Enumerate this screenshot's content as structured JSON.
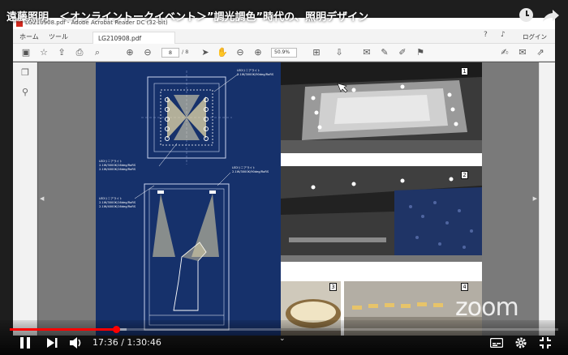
{
  "video": {
    "title": "遠藤照明　＜オンライントークイベント＞”調光調色”時代の、照明デザイン",
    "elapsed": "17:36",
    "separator": " / ",
    "duration": "1:30:46",
    "progress": 0.194,
    "buffered": 0.213
  },
  "acrobat": {
    "window_title": "LG210908.pdf - Adobe Acrobat Reader DC (32-bit)",
    "menu": {
      "home": "ホーム",
      "tools": "ツール",
      "doc_tab": "LG210908.pdf"
    },
    "login": "ログイン",
    "current_page": "8",
    "total_pages": "/ 8",
    "zoom": "50.9%"
  },
  "blueprint": {
    "label_a_1": "LEDリニアライト",
    "label_a_2": "2.1W/3000K/90deg/RaRS",
    "label_b_1": "LEDリニアライト",
    "label_b_2": "2.1W/3000K/16deg/RaRS",
    "label_b_3": "2.1W/4000K/16deg/RaRS",
    "label_c_1": "LEDリニアライト",
    "label_c_2": "2.1W/3000K/90deg/RaRS",
    "label_d_1": "LEDリニアライト",
    "label_d_2": "2.1W/3000K/16deg/RaRS",
    "label_d_3": "2.1W/4000K/16deg/RaRS"
  },
  "photos": {
    "n1": "1",
    "n2": "2",
    "n3": "3",
    "n4": "4"
  },
  "watermark": "zoom",
  "colors": {
    "blueprint": "#16316b",
    "progress": "#ff0000",
    "pdf_red": "#d42a1f"
  }
}
